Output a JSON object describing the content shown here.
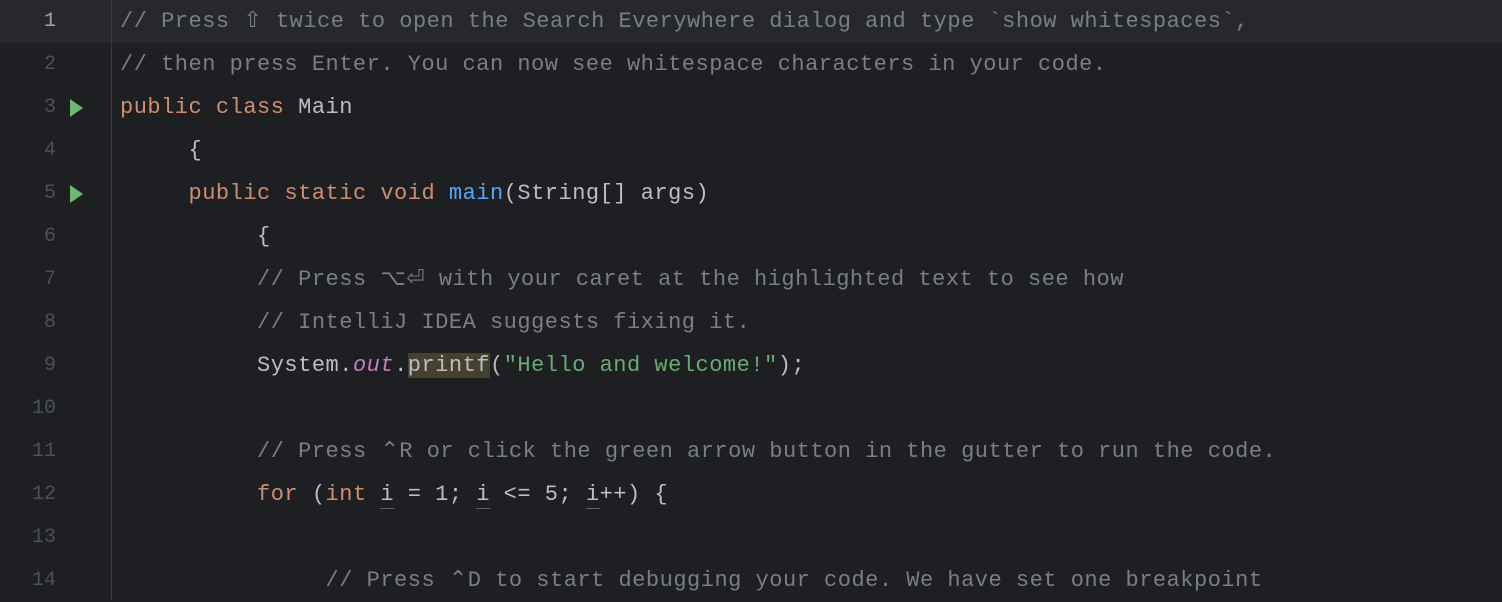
{
  "editor": {
    "run_markers": [
      3,
      5
    ],
    "highlighted_line": 1,
    "lines": [
      {
        "n": 1,
        "tokens": [
          {
            "t": "// Press ⇧ twice to open the Search Everywhere dialog and type `show whitespaces`,",
            "cls": "c-comment"
          }
        ]
      },
      {
        "n": 2,
        "tokens": [
          {
            "t": "// then press Enter. You can now see whitespace characters in your code.",
            "cls": "c-comment"
          }
        ]
      },
      {
        "n": 3,
        "tokens": [
          {
            "t": "public",
            "cls": "c-keyword"
          },
          {
            "t": " ",
            "cls": ""
          },
          {
            "t": "class",
            "cls": "c-keyword"
          },
          {
            "t": " ",
            "cls": ""
          },
          {
            "t": "Main",
            "cls": "c-class"
          }
        ]
      },
      {
        "n": 4,
        "indent": 1,
        "tokens": [
          {
            "t": "{",
            "cls": "c-paren"
          }
        ]
      },
      {
        "n": 5,
        "indent": 1,
        "tokens": [
          {
            "t": "public",
            "cls": "c-keyword"
          },
          {
            "t": " ",
            "cls": ""
          },
          {
            "t": "static",
            "cls": "c-keyword"
          },
          {
            "t": " ",
            "cls": ""
          },
          {
            "t": "void",
            "cls": "c-keyword"
          },
          {
            "t": " ",
            "cls": ""
          },
          {
            "t": "main",
            "cls": "c-method"
          },
          {
            "t": "(",
            "cls": "c-paren"
          },
          {
            "t": "String[] args",
            "cls": "c-class"
          },
          {
            "t": ")",
            "cls": "c-paren"
          }
        ]
      },
      {
        "n": 6,
        "indent": 2,
        "tokens": [
          {
            "t": "{",
            "cls": "c-paren"
          }
        ]
      },
      {
        "n": 7,
        "indent": 2,
        "tokens": [
          {
            "t": "// Press ⌥⏎ with your caret at the highlighted text to see how",
            "cls": "c-comment"
          }
        ]
      },
      {
        "n": 8,
        "indent": 2,
        "tokens": [
          {
            "t": "// IntelliJ IDEA suggests fixing it.",
            "cls": "c-comment"
          }
        ]
      },
      {
        "n": 9,
        "indent": 2,
        "tokens": [
          {
            "t": "System",
            "cls": "c-class"
          },
          {
            "t": ".",
            "cls": "c-punct"
          },
          {
            "t": "out",
            "cls": "c-field"
          },
          {
            "t": ".",
            "cls": "c-punct"
          },
          {
            "t": "printf",
            "cls": "c-methodc hl-warn"
          },
          {
            "t": "(",
            "cls": "c-paren"
          },
          {
            "t": "\"Hello and welcome!\"",
            "cls": "c-string"
          },
          {
            "t": ")",
            "cls": "c-paren"
          },
          {
            "t": ";",
            "cls": "c-punct"
          }
        ]
      },
      {
        "n": 10,
        "indent": 2,
        "tokens": []
      },
      {
        "n": 11,
        "indent": 2,
        "tokens": [
          {
            "t": "// Press ⌃R or click the green arrow button in the gutter to run the code.",
            "cls": "c-comment"
          }
        ]
      },
      {
        "n": 12,
        "indent": 2,
        "tokens": [
          {
            "t": "for",
            "cls": "c-keyword"
          },
          {
            "t": " (",
            "cls": "c-paren"
          },
          {
            "t": "int",
            "cls": "c-keyword"
          },
          {
            "t": " ",
            "cls": ""
          },
          {
            "t": "i",
            "cls": "c-class c-under"
          },
          {
            "t": " = ",
            "cls": "c-punct"
          },
          {
            "t": "1",
            "cls": "c-class"
          },
          {
            "t": "; ",
            "cls": "c-punct"
          },
          {
            "t": "i",
            "cls": "c-class c-under"
          },
          {
            "t": " <= ",
            "cls": "c-punct"
          },
          {
            "t": "5",
            "cls": "c-class"
          },
          {
            "t": "; ",
            "cls": "c-punct"
          },
          {
            "t": "i",
            "cls": "c-class c-under"
          },
          {
            "t": "++",
            "cls": "c-punct"
          },
          {
            "t": ") {",
            "cls": "c-paren"
          }
        ]
      },
      {
        "n": 13,
        "indent": 2,
        "tokens": []
      },
      {
        "n": 14,
        "indent": 3,
        "tokens": [
          {
            "t": "// Press ⌃D to start debugging your code. We have set one breakpoint",
            "cls": "c-comment"
          }
        ]
      }
    ]
  }
}
